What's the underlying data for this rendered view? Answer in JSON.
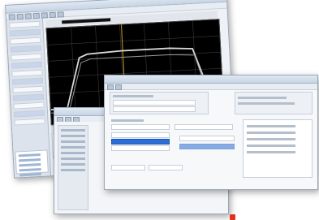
{
  "colors": {
    "scope_background": "#000000",
    "trace": "#d9d9d9",
    "grid": "#3a3a3a",
    "highlight": "#2b6fd6",
    "accent": "#e0301e"
  },
  "icons": {
    "scope_marker": "triangle-marker-icon"
  }
}
